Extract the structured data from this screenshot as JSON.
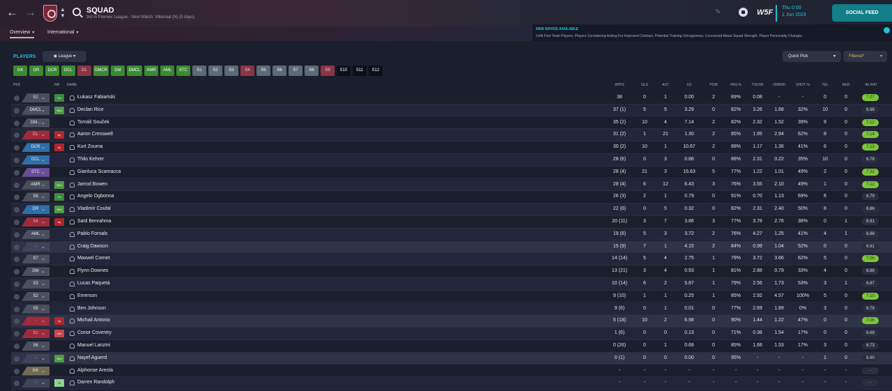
{
  "header": {
    "title": "SQUAD",
    "subtitle": "3rd in Premier League - Next Match: Villarreal (N) (5 days)",
    "date_line1": "Thu 0:00",
    "date_line2": "1 Jun 2023",
    "social_feed": "SOCIAL FEED",
    "brand": "W5F"
  },
  "tabs": {
    "overview": "Overview",
    "international": "International"
  },
  "advice": {
    "title": "NEW ADVICE AVAILABLE",
    "body": "Unfit First Team Players, Players Considering Asking For Improved Contract, Potential Training Unhappiness, Concerned About Squad Strength, Player Personality Changes"
  },
  "players_label": "PLAYERS",
  "league_dd": "League",
  "quick_pick": "Quick Pick",
  "filtered": "Filtered*",
  "position_buttons": [
    "GK",
    "DR",
    "DCR",
    "DCL",
    "DL",
    "DMCR",
    "DM",
    "DMCL",
    "AMR",
    "AML",
    "STC",
    "S1",
    "S2",
    "S3",
    "S4",
    "S5",
    "S6",
    "S7",
    "S8",
    "S9",
    "S10",
    "S11",
    "S12"
  ],
  "columns": {
    "pkd": "PKD",
    "inf": "INF",
    "name": "NAME",
    "apps": "APPS",
    "gls": "GLS",
    "ast": "AST",
    "xg": "XG",
    "pom": "POM",
    "pas": "PAS %",
    "tck": "TCK/90",
    "drb": "DRB/90",
    "shot": "SHOT %",
    "yel": "YEL",
    "red": "RED",
    "avrat": "AV RAT"
  },
  "rows": [
    {
      "pkd": "S1",
      "inf": "Tm",
      "name": "Łukasz Fabiański",
      "apps": "38",
      "gls": "0",
      "ast": "1",
      "xg": "0.00",
      "pom": "2",
      "pas": "89%",
      "tck": "0.08",
      "drb": "-",
      "shot": "-",
      "yel": "0",
      "red": "0",
      "av": "7.07"
    },
    {
      "pkd": "DMCL",
      "inf": "Wnt",
      "name": "Declan Rice",
      "apps": "37 (1)",
      "gls": "5",
      "ast": "5",
      "xg": "3.29",
      "pom": "0",
      "pas": "82%",
      "tck": "3.26",
      "drb": "1.68",
      "shot": "32%",
      "yel": "10",
      "red": "0",
      "av": "6.98"
    },
    {
      "pkd": "DM...",
      "inf": "",
      "name": "Tomáš Souček",
      "apps": "35 (2)",
      "gls": "10",
      "ast": "4",
      "xg": "7.14",
      "pom": "2",
      "pas": "82%",
      "tck": "2.32",
      "drb": "1.52",
      "shot": "39%",
      "yel": "9",
      "red": "0",
      "av": "7.12"
    },
    {
      "pkd": "DL",
      "inf": "Inj",
      "name": "Aaron Cresswell",
      "apps": "31 (2)",
      "gls": "1",
      "ast": "21",
      "xg": "1.30",
      "pom": "2",
      "pas": "85%",
      "tck": "1.95",
      "drb": "2.94",
      "shot": "62%",
      "yel": "8",
      "red": "0",
      "av": "7.14"
    },
    {
      "pkd": "DCR",
      "inf": "Inj",
      "name": "Kurt Zouma",
      "apps": "30 (2)",
      "gls": "10",
      "ast": "1",
      "xg": "10.67",
      "pom": "2",
      "pas": "88%",
      "tck": "1.17",
      "drb": "1.36",
      "shot": "41%",
      "yel": "6",
      "red": "0",
      "av": "7.13"
    },
    {
      "pkd": "DCL",
      "inf": "",
      "name": "Thilo Kehrer",
      "apps": "28 (6)",
      "gls": "0",
      "ast": "3",
      "xg": "0.86",
      "pom": "0",
      "pas": "86%",
      "tck": "2.31",
      "drb": "0.22",
      "shot": "35%",
      "yel": "10",
      "red": "0",
      "av": "6.78"
    },
    {
      "pkd": "STC",
      "inf": "",
      "name": "Gianluca Scamacca",
      "apps": "28 (4)",
      "gls": "21",
      "ast": "3",
      "xg": "16.63",
      "pom": "5",
      "pas": "77%",
      "tck": "1.22",
      "drb": "1.01",
      "shot": "49%",
      "yel": "2",
      "red": "0",
      "av": "7.32"
    },
    {
      "pkd": "AMR",
      "inf": "Wnt",
      "name": "Jarrod Bowen",
      "apps": "28 (4)",
      "gls": "6",
      "ast": "12",
      "xg": "6.43",
      "pom": "3",
      "pas": "76%",
      "tck": "3.55",
      "drb": "2.10",
      "shot": "49%",
      "yel": "1",
      "red": "0",
      "av": "7.12"
    },
    {
      "pkd": "S8",
      "inf": "Tm",
      "name": "Angelo Ogbonna",
      "apps": "26 (3)",
      "gls": "2",
      "ast": "1",
      "xg": "0.79",
      "pom": "0",
      "pas": "91%",
      "tck": "0.70",
      "drb": "1.13",
      "shot": "69%",
      "yel": "6",
      "red": "0",
      "av": "6.79"
    },
    {
      "pkd": "DR",
      "inf": "Wnt",
      "name": "Vladimír Coufal",
      "apps": "22 (6)",
      "gls": "0",
      "ast": "5",
      "xg": "0.32",
      "pom": "0",
      "pas": "82%",
      "tck": "2.31",
      "drb": "2.40",
      "shot": "50%",
      "yel": "8",
      "red": "0",
      "av": "6.86"
    },
    {
      "pkd": "S4",
      "inf": "Inj",
      "name": "Saïd Benrahma",
      "apps": "20 (11)",
      "gls": "3",
      "ast": "7",
      "xg": "3.86",
      "pom": "3",
      "pas": "77%",
      "tck": "3.78",
      "drb": "2.76",
      "shot": "38%",
      "yel": "0",
      "red": "1",
      "av": "6.91"
    },
    {
      "pkd": "AML",
      "inf": "",
      "name": "Pablo Fornals",
      "apps": "19 (6)",
      "gls": "5",
      "ast": "3",
      "xg": "3.72",
      "pom": "2",
      "pas": "76%",
      "tck": "4.27",
      "drb": "1.25",
      "shot": "41%",
      "yel": "4",
      "red": "1",
      "av": "6.88"
    },
    {
      "pkd": "-",
      "inf": "",
      "name": "Craig Dawson",
      "apps": "15 (9)",
      "gls": "7",
      "ast": "1",
      "xg": "4.15",
      "pom": "2",
      "pas": "84%",
      "tck": "0.99",
      "drb": "1.04",
      "shot": "52%",
      "yel": "0",
      "red": "0",
      "av": "6.91"
    },
    {
      "pkd": "S7",
      "inf": "",
      "name": "Maxwel Cornet",
      "apps": "14 (14)",
      "gls": "5",
      "ast": "4",
      "xg": "2.75",
      "pom": "1",
      "pas": "79%",
      "tck": "3.72",
      "drb": "3.66",
      "shot": "62%",
      "yel": "5",
      "red": "0",
      "av": "7.06"
    },
    {
      "pkd": "DM",
      "inf": "",
      "name": "Flynn Downes",
      "apps": "13 (21)",
      "gls": "3",
      "ast": "4",
      "xg": "0.93",
      "pom": "1",
      "pas": "81%",
      "tck": "2.88",
      "drb": "0.79",
      "shot": "33%",
      "yel": "4",
      "red": "0",
      "av": "6.86"
    },
    {
      "pkd": "S3",
      "inf": "",
      "name": "Lucas Paquetá",
      "apps": "10 (14)",
      "gls": "6",
      "ast": "2",
      "xg": "5.87",
      "pom": "1",
      "pas": "79%",
      "tck": "2.56",
      "drb": "1.73",
      "shot": "53%",
      "yel": "3",
      "red": "1",
      "av": "6.87"
    },
    {
      "pkd": "S2",
      "inf": "",
      "name": "Emerson",
      "apps": "9 (10)",
      "gls": "1",
      "ast": "1",
      "xg": "0.25",
      "pom": "1",
      "pas": "85%",
      "tck": "2.92",
      "drb": "4.57",
      "shot": "100%",
      "yel": "5",
      "red": "0",
      "av": "7.10"
    },
    {
      "pkd": "S5",
      "inf": "",
      "name": "Ben Johnson",
      "apps": "9 (6)",
      "gls": "0",
      "ast": "1",
      "xg": "0.01",
      "pom": "0",
      "pas": "77%",
      "tck": "2.69",
      "drb": "1.89",
      "shot": "0%",
      "yel": "3",
      "red": "0",
      "av": "6.79"
    },
    {
      "pkd": "-",
      "inf": "Inj",
      "name": "Michail Antonio",
      "apps": "5 (18)",
      "gls": "10",
      "ast": "2",
      "xg": "6.98",
      "pom": "0",
      "pas": "90%",
      "tck": "1.44",
      "drb": "1.22",
      "shot": "47%",
      "yel": "0",
      "red": "0",
      "av": "7.06"
    },
    {
      "pkd": "S1",
      "inf": "Unr",
      "name": "Conor Coventry",
      "apps": "1 (6)",
      "gls": "0",
      "ast": "0",
      "xg": "0.13",
      "pom": "0",
      "pas": "71%",
      "tck": "0.38",
      "drb": "1.54",
      "shot": "17%",
      "yel": "0",
      "red": "0",
      "av": "6.69"
    },
    {
      "pkd": "S6",
      "inf": "",
      "name": "Manuel Lanzini",
      "apps": "0 (26)",
      "gls": "0",
      "ast": "1",
      "xg": "0.68",
      "pom": "0",
      "pas": "85%",
      "tck": "1.68",
      "drb": "1.53",
      "shot": "17%",
      "yel": "3",
      "red": "0",
      "av": "6.73"
    },
    {
      "pkd": "-",
      "inf": "Wnt",
      "name": "Nayef Aguerd",
      "apps": "0 (1)",
      "gls": "0",
      "ast": "0",
      "xg": "0.00",
      "pom": "0",
      "pas": "95%",
      "tck": "-",
      "drb": "-",
      "shot": "-",
      "yel": "1",
      "red": "0",
      "av": "6.90"
    },
    {
      "pkd": "GK",
      "inf": "",
      "name": "Alphonse Areola",
      "apps": "-",
      "gls": "-",
      "ast": "-",
      "xg": "-",
      "pom": "-",
      "pas": "-",
      "tck": "-",
      "drb": "-",
      "shot": "-",
      "yel": "-",
      "red": "-",
      "av": "-"
    },
    {
      "pkd": "-",
      "inf": "St",
      "name": "Darren Randolph",
      "apps": "-",
      "gls": "-",
      "ast": "-",
      "xg": "-",
      "pom": "-",
      "pas": "-",
      "tck": "-",
      "drb": "-",
      "shot": "-",
      "yel": "-",
      "red": "-",
      "av": "-"
    }
  ]
}
